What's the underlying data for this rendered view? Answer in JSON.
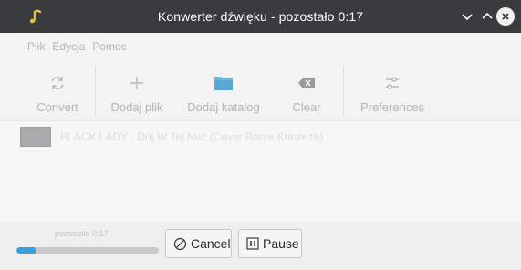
{
  "window": {
    "title": "Konwerter dźwięku - pozostało 0:17",
    "app_icon": "music-note-icon",
    "controls": [
      "minimize-icon",
      "maximize-icon",
      "close-icon"
    ]
  },
  "menu": {
    "items": [
      {
        "label": "Plik"
      },
      {
        "label": "Edycja"
      },
      {
        "label": "Pomoc"
      }
    ]
  },
  "toolbar": {
    "convert": {
      "label": "Convert",
      "icon": "refresh-icon"
    },
    "add_file": {
      "label": "Dodaj plik",
      "icon": "plus-icon"
    },
    "add_folder": {
      "label": "Dodaj katalog",
      "icon": "folder-icon"
    },
    "clear": {
      "label": "Clear",
      "icon": "backspace-icon"
    },
    "preferences": {
      "label": "Preferences",
      "icon": "sliders-icon"
    }
  },
  "files": [
    {
      "name": "BLACK LADY · Dūj W Tej Nuc (Cover Borze Krinzeza)"
    }
  ],
  "status": {
    "remaining": "pozostało 0:17",
    "progress_fraction": 0.14
  },
  "buttons": {
    "cancel": {
      "label": "Cancel",
      "icon": "cancel-circle-icon"
    },
    "pause": {
      "label": "Pause",
      "icon": "pause-icon"
    }
  },
  "colors": {
    "titlebar": "#3a3b3d",
    "progress_fill": "#3d9de0"
  }
}
